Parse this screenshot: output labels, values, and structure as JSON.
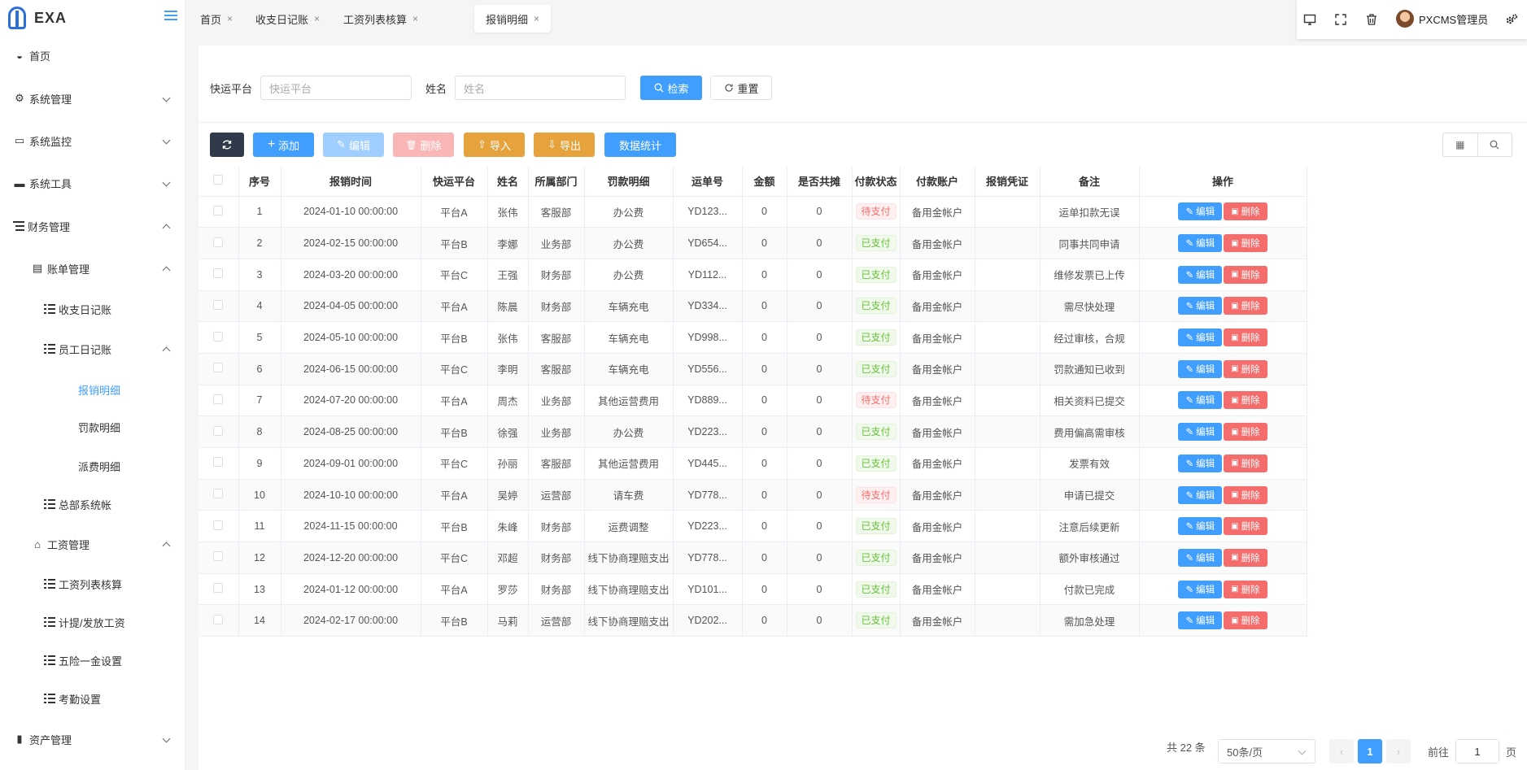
{
  "app": {
    "logo_text": "EXA"
  },
  "sidebar": {
    "items": [
      {
        "label": "首页",
        "icon": "dashboard-icon"
      },
      {
        "label": "系统管理",
        "icon": "gear-icon"
      },
      {
        "label": "系统监控",
        "icon": "monitor-icon"
      },
      {
        "label": "系统工具",
        "icon": "toolbox-icon"
      },
      {
        "label": "财务管理",
        "icon": "tree-icon"
      },
      {
        "label": "账单管理",
        "icon": "document-icon"
      },
      {
        "label": "收支日记账",
        "icon": "list-icon"
      },
      {
        "label": "员工日记账",
        "icon": "list-icon"
      },
      {
        "label": "报销明细"
      },
      {
        "label": "罚款明细"
      },
      {
        "label": "派费明细"
      },
      {
        "label": "总部系统帐",
        "icon": "list-icon"
      },
      {
        "label": "工资管理",
        "icon": "bell-icon"
      },
      {
        "label": "工资列表核算",
        "icon": "list-icon"
      },
      {
        "label": "计提/发放工资",
        "icon": "list-icon"
      },
      {
        "label": "五险一金设置",
        "icon": "list-icon"
      },
      {
        "label": "考勤设置",
        "icon": "list-icon"
      },
      {
        "label": "资产管理",
        "icon": "chart-icon"
      }
    ]
  },
  "tabs": [
    {
      "label": "首页"
    },
    {
      "label": "收支日记账"
    },
    {
      "label": "工资列表核算"
    },
    {
      "label": "报销明细"
    }
  ],
  "header": {
    "username": "PXCMS管理员"
  },
  "search": {
    "platform_label": "快运平台",
    "platform_placeholder": "快运平台",
    "name_label": "姓名",
    "name_placeholder": "姓名",
    "search_button": "检索",
    "reset_button": "重置"
  },
  "actions": {
    "add": "添加",
    "edit": "编辑",
    "delete": "删除",
    "import": "导入",
    "export": "导出",
    "stats": "数据统计"
  },
  "table": {
    "headers": [
      "序号",
      "报销时间",
      "快运平台",
      "姓名",
      "所属部门",
      "罚款明细",
      "运单号",
      "金额",
      "是否共摊",
      "付款状态",
      "付款账户",
      "报销凭证",
      "备注",
      "操作"
    ],
    "rows": [
      {
        "no": "1",
        "time": "2024-01-10 00:00:00",
        "platform": "平台A",
        "name": "张伟",
        "dept": "客服部",
        "detail": "办公费",
        "waybill": "YD123...",
        "amount": "0",
        "shared": "0",
        "status": "待支付",
        "account": "备用金帐户",
        "voucher": "",
        "remark": "运单扣款无误"
      },
      {
        "no": "2",
        "time": "2024-02-15 00:00:00",
        "platform": "平台B",
        "name": "李娜",
        "dept": "业务部",
        "detail": "办公费",
        "waybill": "YD654...",
        "amount": "0",
        "shared": "0",
        "status": "已支付",
        "account": "备用金帐户",
        "voucher": "",
        "remark": "同事共同申请"
      },
      {
        "no": "3",
        "time": "2024-03-20 00:00:00",
        "platform": "平台C",
        "name": "王强",
        "dept": "财务部",
        "detail": "办公费",
        "waybill": "YD112...",
        "amount": "0",
        "shared": "0",
        "status": "已支付",
        "account": "备用金帐户",
        "voucher": "",
        "remark": "维修发票已上传"
      },
      {
        "no": "4",
        "time": "2024-04-05 00:00:00",
        "platform": "平台A",
        "name": "陈晨",
        "dept": "财务部",
        "detail": "车辆充电",
        "waybill": "YD334...",
        "amount": "0",
        "shared": "0",
        "status": "已支付",
        "account": "备用金帐户",
        "voucher": "",
        "remark": "需尽快处理"
      },
      {
        "no": "5",
        "time": "2024-05-10 00:00:00",
        "platform": "平台B",
        "name": "张伟",
        "dept": "客服部",
        "detail": "车辆充电",
        "waybill": "YD998...",
        "amount": "0",
        "shared": "0",
        "status": "已支付",
        "account": "备用金帐户",
        "voucher": "",
        "remark": "经过审核，合规"
      },
      {
        "no": "6",
        "time": "2024-06-15 00:00:00",
        "platform": "平台C",
        "name": "李明",
        "dept": "客服部",
        "detail": "车辆充电",
        "waybill": "YD556...",
        "amount": "0",
        "shared": "0",
        "status": "已支付",
        "account": "备用金帐户",
        "voucher": "",
        "remark": "罚款通知已收到"
      },
      {
        "no": "7",
        "time": "2024-07-20 00:00:00",
        "platform": "平台A",
        "name": "周杰",
        "dept": "业务部",
        "detail": "其他运营费用",
        "waybill": "YD889...",
        "amount": "0",
        "shared": "0",
        "status": "待支付",
        "account": "备用金帐户",
        "voucher": "",
        "remark": "相关资料已提交"
      },
      {
        "no": "8",
        "time": "2024-08-25 00:00:00",
        "platform": "平台B",
        "name": "徐强",
        "dept": "业务部",
        "detail": "办公费",
        "waybill": "YD223...",
        "amount": "0",
        "shared": "0",
        "status": "已支付",
        "account": "备用金帐户",
        "voucher": "",
        "remark": "费用偏高需审核"
      },
      {
        "no": "9",
        "time": "2024-09-01 00:00:00",
        "platform": "平台C",
        "name": "孙丽",
        "dept": "客服部",
        "detail": "其他运营费用",
        "waybill": "YD445...",
        "amount": "0",
        "shared": "0",
        "status": "已支付",
        "account": "备用金帐户",
        "voucher": "",
        "remark": "发票有效"
      },
      {
        "no": "10",
        "time": "2024-10-10 00:00:00",
        "platform": "平台A",
        "name": "吴婷",
        "dept": "运营部",
        "detail": "请车费",
        "waybill": "YD778...",
        "amount": "0",
        "shared": "0",
        "status": "待支付",
        "account": "备用金帐户",
        "voucher": "",
        "remark": "申请已提交"
      },
      {
        "no": "11",
        "time": "2024-11-15 00:00:00",
        "platform": "平台B",
        "name": "朱峰",
        "dept": "财务部",
        "detail": "运费调整",
        "waybill": "YD223...",
        "amount": "0",
        "shared": "0",
        "status": "已支付",
        "account": "备用金帐户",
        "voucher": "",
        "remark": "注意后续更新"
      },
      {
        "no": "12",
        "time": "2024-12-20 00:00:00",
        "platform": "平台C",
        "name": "邓超",
        "dept": "财务部",
        "detail": "线下协商理赔支出",
        "waybill": "YD778...",
        "amount": "0",
        "shared": "0",
        "status": "已支付",
        "account": "备用金帐户",
        "voucher": "",
        "remark": "额外审核通过"
      },
      {
        "no": "13",
        "time": "2024-01-12 00:00:00",
        "platform": "平台A",
        "name": "罗莎",
        "dept": "财务部",
        "detail": "线下协商理赔支出",
        "waybill": "YD101...",
        "amount": "0",
        "shared": "0",
        "status": "已支付",
        "account": "备用金帐户",
        "voucher": "",
        "remark": "付款已完成"
      },
      {
        "no": "14",
        "time": "2024-02-17 00:00:00",
        "platform": "平台B",
        "name": "马莉",
        "dept": "运营部",
        "detail": "线下协商理赔支出",
        "waybill": "YD202...",
        "amount": "0",
        "shared": "0",
        "status": "已支付",
        "account": "备用金帐户",
        "voucher": "",
        "remark": "需加急处理"
      }
    ],
    "row_edit": "编辑",
    "row_delete": "删除"
  },
  "pagination": {
    "total": "共 22 条",
    "page_size": "50条/页",
    "current_page": "1",
    "goto_label": "前往",
    "goto_value": "1",
    "page_suffix": "页"
  },
  "colors": {
    "primary": "#409eff",
    "danger": "#f56c6c",
    "warning": "#e6a23c",
    "dark": "#2f3b4a"
  }
}
